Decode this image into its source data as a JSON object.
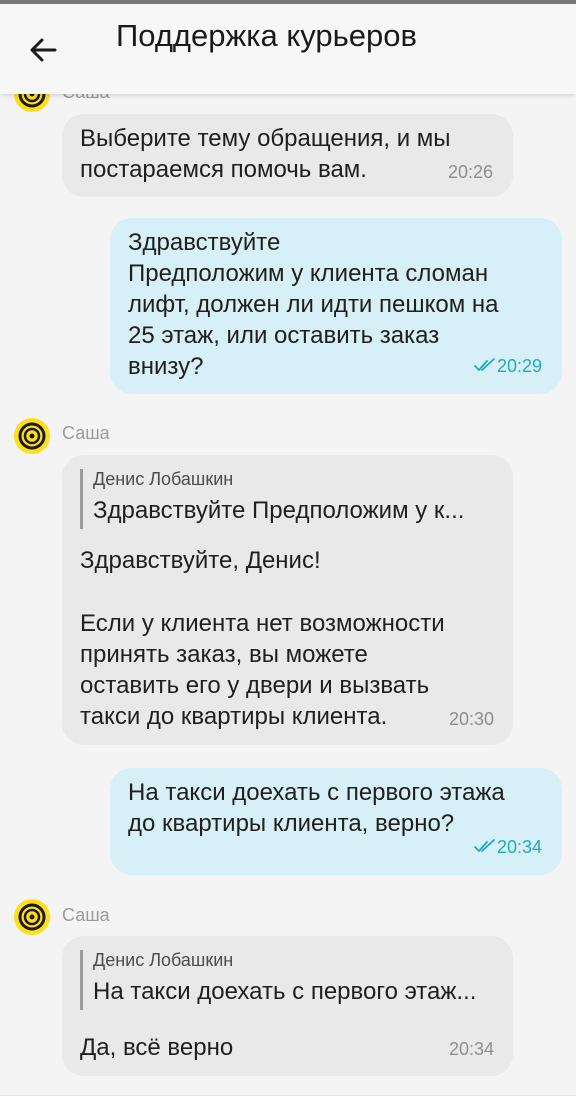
{
  "header": {
    "title": "Поддержка курьеров",
    "back_icon": "arrow-left-icon"
  },
  "colors": {
    "avatar": "#ffde1a",
    "incoming_bubble": "#e9e9e9",
    "outgoing_bubble": "#d7eff6",
    "read_time": "#21a9c4"
  },
  "messages": [
    {
      "sender": "Саша",
      "lines": [
        "Выберите тему обращения, и мы",
        "постараемся помочь вам."
      ],
      "time": "20:26"
    },
    {
      "lines": [
        "Здравствуйте",
        "Предположим у клиента сломан",
        "лифт, должен ли идти пешком на",
        "25 этаж, или оставить заказ",
        "внизу?"
      ],
      "time": "20:29",
      "status": "read"
    },
    {
      "sender": "Саша",
      "quote": {
        "author": "Денис Лобашкин",
        "text": "Здравствуйте Предположим у к..."
      },
      "lines": [
        "Здравствуйте, Денис!",
        "",
        "Если у клиента нет возможности",
        "принять заказ, вы можете",
        "оставить его у двери и вызвать",
        "такси до квартиры клиента."
      ],
      "time": "20:30"
    },
    {
      "lines": [
        "На такси доехать с первого этажа",
        "до квартиры клиента, верно?"
      ],
      "time": "20:34",
      "status": "read"
    },
    {
      "sender": "Саша",
      "quote": {
        "author": "Денис Лобашкин",
        "text": "На такси доехать с первого этаж..."
      },
      "lines": [
        "Да, всё верно"
      ],
      "time": "20:34"
    }
  ]
}
